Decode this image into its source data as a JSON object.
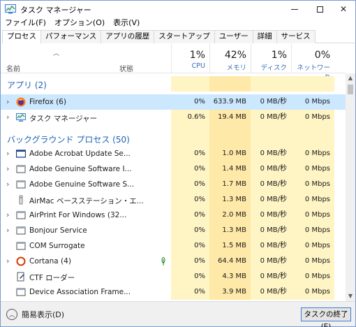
{
  "window": {
    "title": "タスク マネージャー"
  },
  "menu": [
    "ファイル(F)",
    "オプション(O)",
    "表示(V)"
  ],
  "tabs": [
    "プロセス",
    "パフォーマンス",
    "アプリの履歴",
    "スタートアップ",
    "ユーザー",
    "詳細",
    "サービス"
  ],
  "header": {
    "name": "名前",
    "status": "状態",
    "cpu_pct": "1%",
    "cpu_label": "CPU",
    "mem_pct": "42%",
    "mem_label": "メモリ",
    "disk_pct": "1%",
    "disk_label": "ディスク",
    "net_pct": "0%",
    "net_label": "ネットワーク"
  },
  "groups": {
    "apps": "アプリ (2)",
    "background": "バックグラウンド プロセス (50)"
  },
  "apps": [
    {
      "name": "Firefox (6)",
      "icon": "firefox-icon",
      "cpu": "0%",
      "mem": "633.9 MB",
      "disk": "0 MB/秒",
      "net": "0 Mbps"
    },
    {
      "name": "タスク マネージャー",
      "icon": "task-manager-icon",
      "cpu": "0.6%",
      "mem": "19.4 MB",
      "disk": "0 MB/秒",
      "net": "0 Mbps"
    }
  ],
  "background": [
    {
      "name": "Adobe Acrobat Update Se...",
      "icon": "window-icon",
      "cpu": "0%",
      "mem": "1.0 MB",
      "disk": "0 MB/秒",
      "net": "0 Mbps"
    },
    {
      "name": "Adobe Genuine Software I...",
      "icon": "window-icon",
      "cpu": "0%",
      "mem": "1.4 MB",
      "disk": "0 MB/秒",
      "net": "0 Mbps"
    },
    {
      "name": "Adobe Genuine Software S...",
      "icon": "window-icon",
      "cpu": "0%",
      "mem": "1.7 MB",
      "disk": "0 MB/秒",
      "net": "0 Mbps"
    },
    {
      "name": "AirMac ベースステーション・エ...",
      "icon": "airmac-icon",
      "cpu": "0%",
      "mem": "1.3 MB",
      "disk": "0 MB/秒",
      "net": "0 Mbps"
    },
    {
      "name": "AirPrint For Windows (32...",
      "icon": "window-icon",
      "cpu": "0%",
      "mem": "2.0 MB",
      "disk": "0 MB/秒",
      "net": "0 Mbps"
    },
    {
      "name": "Bonjour Service",
      "icon": "window-icon",
      "cpu": "0%",
      "mem": "1.3 MB",
      "disk": "0 MB/秒",
      "net": "0 Mbps"
    },
    {
      "name": "COM Surrogate",
      "icon": "window-icon",
      "cpu": "0%",
      "mem": "1.5 MB",
      "disk": "0 MB/秒",
      "net": "0 Mbps"
    },
    {
      "name": "Cortana (4)",
      "icon": "cortana-icon",
      "cpu": "0%",
      "mem": "64.4 MB",
      "disk": "0 MB/秒",
      "net": "0 Mbps"
    },
    {
      "name": "CTF ローダー",
      "icon": "ctf-icon",
      "cpu": "0%",
      "mem": "4.3 MB",
      "disk": "0 MB/秒",
      "net": "0 Mbps"
    },
    {
      "name": "Device Association Frame...",
      "icon": "window-icon",
      "cpu": "0%",
      "mem": "3.9 MB",
      "disk": "0 MB/秒",
      "net": "0 Mbps"
    }
  ],
  "footer": {
    "fewer_details": "簡易表示(D)",
    "end_task": "タスクの終了(E)"
  },
  "colors": {
    "group_title": "#1e62b4",
    "selected_row": "#cce8ff",
    "heat_light": "#fff4c4",
    "heat_mem": "#ffe9a8"
  }
}
